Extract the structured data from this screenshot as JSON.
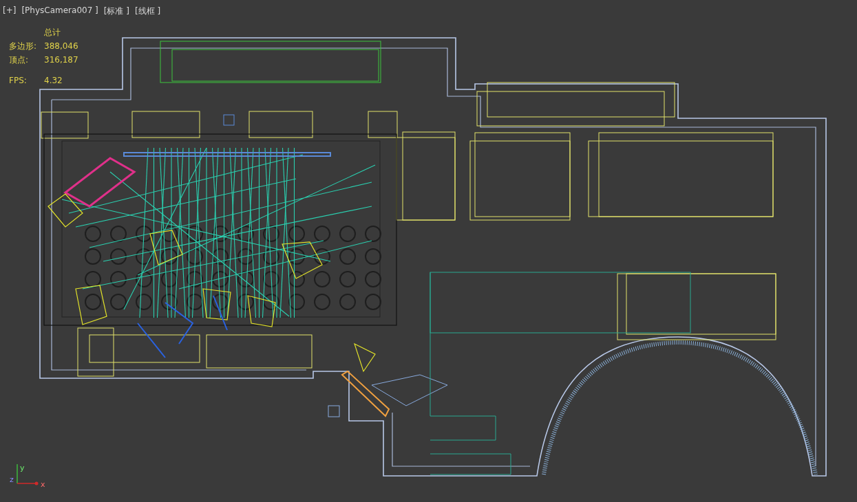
{
  "viewport": {
    "labels": [
      {
        "text": "[+]"
      },
      {
        "text": "[PhysCamera007 ]"
      },
      {
        "text": "[标准 ]"
      },
      {
        "text": "[线框 ]"
      }
    ]
  },
  "stats": {
    "header": "总计",
    "rows": [
      {
        "label": "多边形:",
        "value": "388,046"
      },
      {
        "label": "顶点:",
        "value": "316,187"
      }
    ],
    "fps": {
      "label": "FPS:",
      "value": "4.32"
    }
  },
  "axis": {
    "y": "y",
    "z": "z",
    "x": "x"
  }
}
